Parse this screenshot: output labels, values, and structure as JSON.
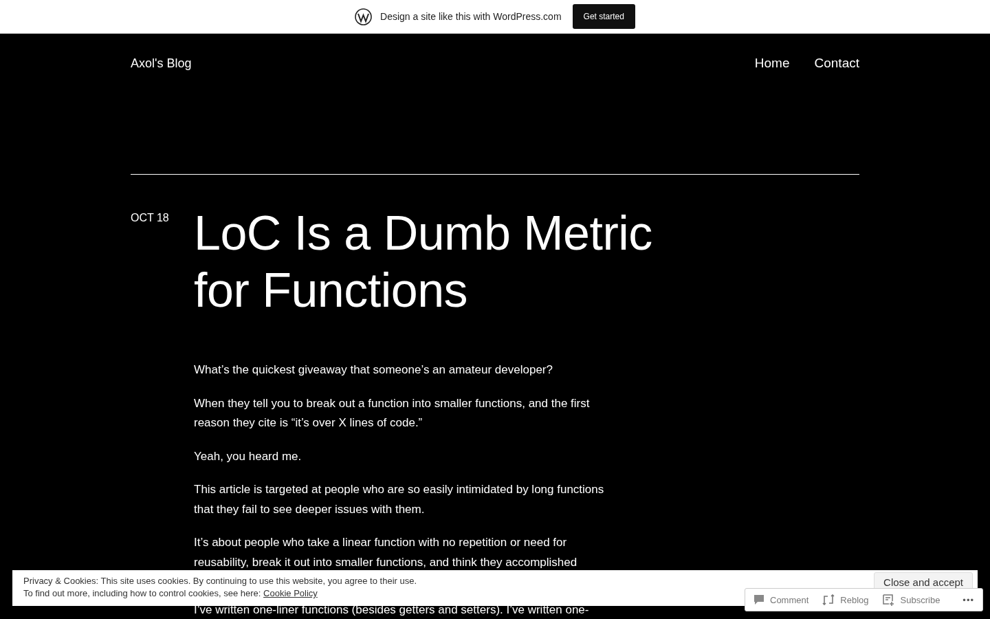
{
  "promo_bar": {
    "text": "Design a site like this with WordPress.com",
    "button": "Get started"
  },
  "header": {
    "site_title": "Axol's Blog",
    "nav": [
      {
        "label": "Home"
      },
      {
        "label": "Contact"
      }
    ]
  },
  "post": {
    "date": "OCT 18",
    "title": "LoC Is a Dumb Metric for Functions",
    "paragraphs": [
      "What’s the quickest giveaway that someone’s an amateur developer?",
      "When they tell you to break out a function into smaller functions, and the first reason they cite is “it’s over X lines of code.”",
      "Yeah, you heard me.",
      "This article is targeted at people who are so easily intimidated by long functions that they fail to see deeper issues with them.",
      "It’s about people who take a linear function with no repetition or need for reusability, break it out into smaller functions, and think they accomplished",
      "I’ve written one-liner functions (besides getters and setters). I’ve written one-"
    ]
  },
  "cookie_banner": {
    "line_1": "Privacy & Cookies: This site uses cookies. By continuing to use this website, you agree to their use.",
    "line_2": "To find out more, including how to control cookies, see here:",
    "link": "Cookie Policy",
    "button": "Close and accept"
  },
  "action_bar": {
    "items": [
      {
        "kind": "comment",
        "label": "Comment"
      },
      {
        "kind": "reblog",
        "label": "Reblog"
      },
      {
        "kind": "subscribe",
        "label": "Subscribe"
      },
      {
        "kind": "more",
        "label": "•••"
      }
    ]
  }
}
